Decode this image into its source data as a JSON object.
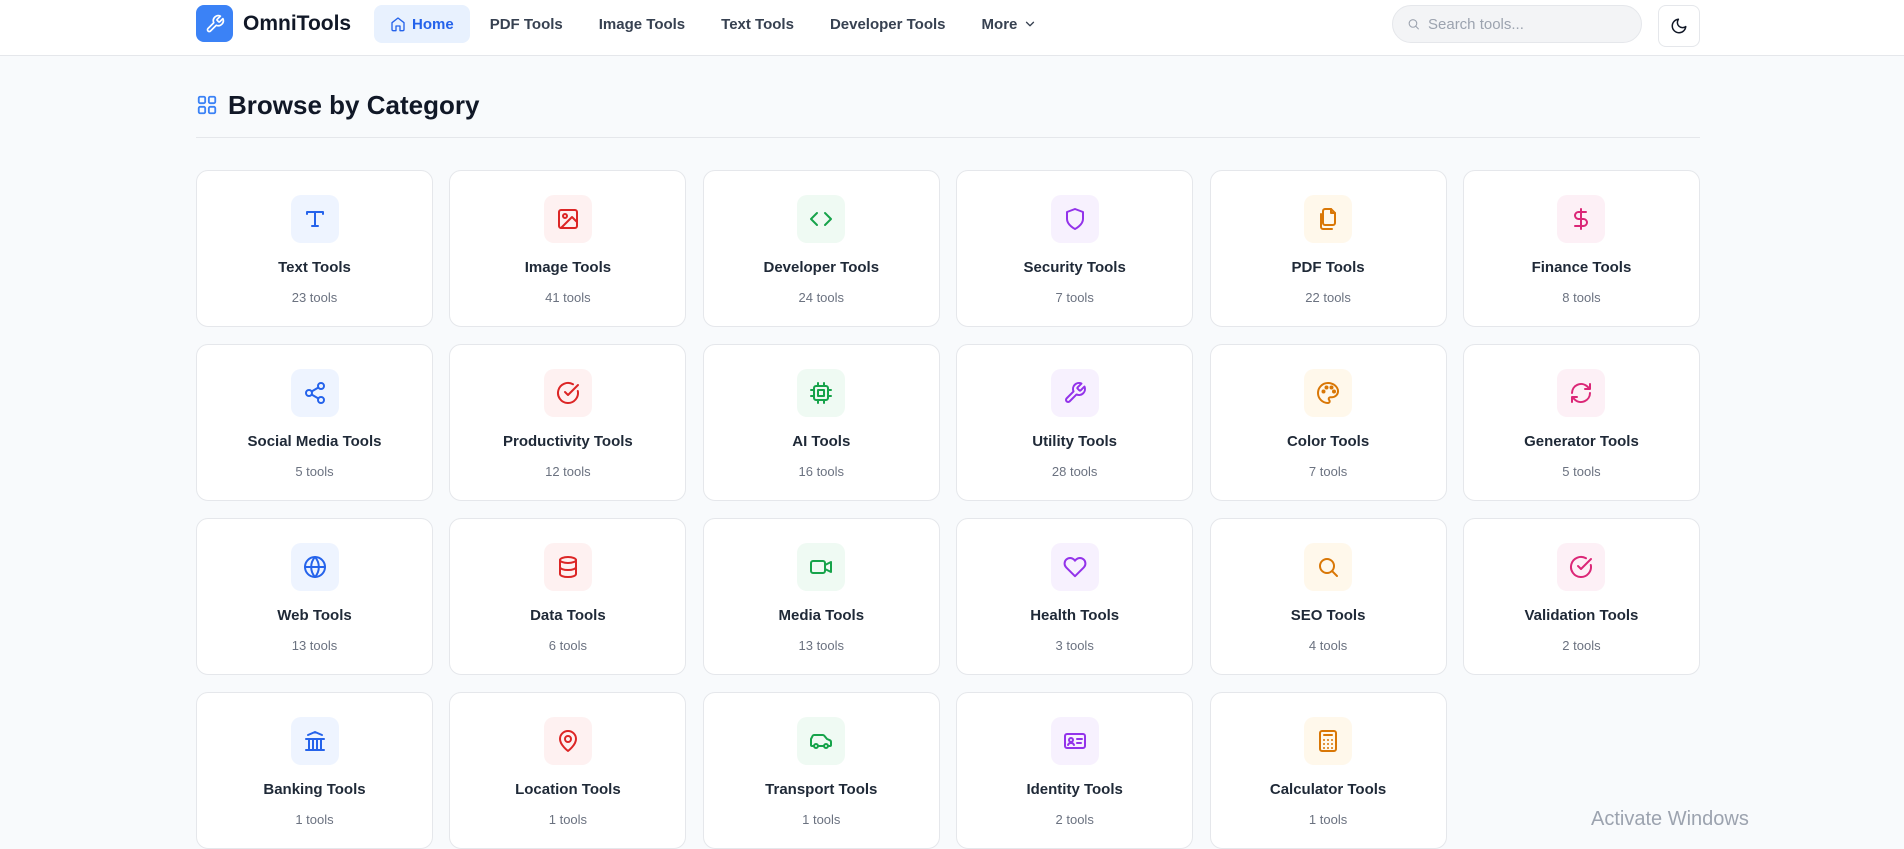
{
  "header": {
    "app_name": "OmniTools",
    "nav": [
      {
        "label": "Home",
        "icon": "home-icon",
        "active": true
      },
      {
        "label": "PDF Tools"
      },
      {
        "label": "Image Tools"
      },
      {
        "label": "Text Tools"
      },
      {
        "label": "Developer Tools"
      },
      {
        "label": "More",
        "icon": "chevron-down-icon"
      }
    ],
    "search_placeholder": "Search tools...",
    "theme_toggle_icon": "moon-icon"
  },
  "main": {
    "title": "Browse by Category",
    "title_icon": "grid-icon",
    "categories": [
      {
        "name": "Text Tools",
        "count": "23 tools",
        "icon": "text-icon",
        "color": "#2563eb",
        "bg": "#eef4ff"
      },
      {
        "name": "Image Tools",
        "count": "41 tools",
        "icon": "image-icon",
        "color": "#dc2626",
        "bg": "#fef1f1"
      },
      {
        "name": "Developer Tools",
        "count": "24 tools",
        "icon": "code-icon",
        "color": "#16a34a",
        "bg": "#effaf3"
      },
      {
        "name": "Security Tools",
        "count": "7 tools",
        "icon": "shield-icon",
        "color": "#9333ea",
        "bg": "#f7f1fe"
      },
      {
        "name": "PDF Tools",
        "count": "22 tools",
        "icon": "files-icon",
        "color": "#d97706",
        "bg": "#fff8eb"
      },
      {
        "name": "Finance Tools",
        "count": "8 tools",
        "icon": "dollar-icon",
        "color": "#db2777",
        "bg": "#fdf0f6"
      },
      {
        "name": "Social Media Tools",
        "count": "5 tools",
        "icon": "share-icon",
        "color": "#2563eb",
        "bg": "#eef4ff"
      },
      {
        "name": "Productivity Tools",
        "count": "12 tools",
        "icon": "check-circle-icon",
        "color": "#dc2626",
        "bg": "#fef1f1"
      },
      {
        "name": "AI Tools",
        "count": "16 tools",
        "icon": "cpu-icon",
        "color": "#16a34a",
        "bg": "#effaf3"
      },
      {
        "name": "Utility Tools",
        "count": "28 tools",
        "icon": "wrench-icon",
        "color": "#9333ea",
        "bg": "#f7f1fe"
      },
      {
        "name": "Color Tools",
        "count": "7 tools",
        "icon": "palette-icon",
        "color": "#d97706",
        "bg": "#fff8eb"
      },
      {
        "name": "Generator Tools",
        "count": "5 tools",
        "icon": "refresh-icon",
        "color": "#db2777",
        "bg": "#fdf0f6"
      },
      {
        "name": "Web Tools",
        "count": "13 tools",
        "icon": "globe-icon",
        "color": "#2563eb",
        "bg": "#eef4ff"
      },
      {
        "name": "Data Tools",
        "count": "6 tools",
        "icon": "database-icon",
        "color": "#dc2626",
        "bg": "#fef1f1"
      },
      {
        "name": "Media Tools",
        "count": "13 tools",
        "icon": "video-icon",
        "color": "#16a34a",
        "bg": "#effaf3"
      },
      {
        "name": "Health Tools",
        "count": "3 tools",
        "icon": "heart-icon",
        "color": "#9333ea",
        "bg": "#f7f1fe"
      },
      {
        "name": "SEO Tools",
        "count": "4 tools",
        "icon": "search-icon",
        "color": "#d97706",
        "bg": "#fff8eb"
      },
      {
        "name": "Validation Tools",
        "count": "2 tools",
        "icon": "check-circle-icon",
        "color": "#db2777",
        "bg": "#fdf0f6"
      },
      {
        "name": "Banking Tools",
        "count": "1 tools",
        "icon": "bank-icon",
        "color": "#2563eb",
        "bg": "#eef4ff"
      },
      {
        "name": "Location Tools",
        "count": "1 tools",
        "icon": "map-pin-icon",
        "color": "#dc2626",
        "bg": "#fef1f1"
      },
      {
        "name": "Transport Tools",
        "count": "1 tools",
        "icon": "car-icon",
        "color": "#16a34a",
        "bg": "#effaf3"
      },
      {
        "name": "Identity Tools",
        "count": "2 tools",
        "icon": "id-card-icon",
        "color": "#9333ea",
        "bg": "#f7f1fe"
      },
      {
        "name": "Calculator Tools",
        "count": "1 tools",
        "icon": "calculator-icon",
        "color": "#d97706",
        "bg": "#fff8eb"
      }
    ]
  },
  "os_overlay": {
    "text": "Activate Windows"
  }
}
